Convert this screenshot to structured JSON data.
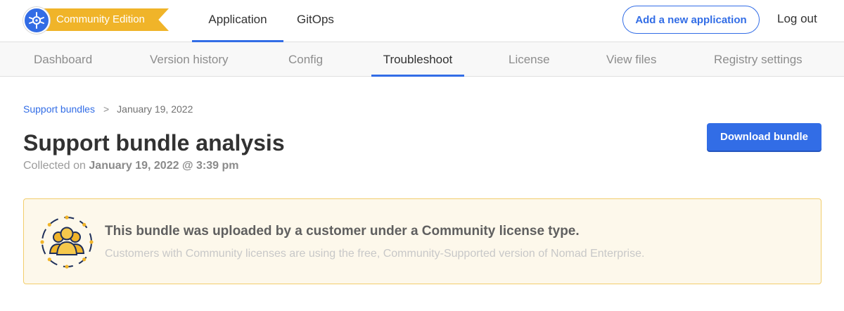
{
  "header": {
    "edition_badge": "Community Edition",
    "tabs": [
      {
        "label": "Application",
        "active": true
      },
      {
        "label": "GitOps",
        "active": false
      }
    ],
    "add_app_label": "Add a new application",
    "logout_label": "Log out"
  },
  "subnav": {
    "tabs": [
      {
        "label": "Dashboard",
        "active": false
      },
      {
        "label": "Version history",
        "active": false
      },
      {
        "label": "Config",
        "active": false
      },
      {
        "label": "Troubleshoot",
        "active": true
      },
      {
        "label": "License",
        "active": false
      },
      {
        "label": "View files",
        "active": false
      },
      {
        "label": "Registry settings",
        "active": false
      }
    ]
  },
  "breadcrumb": {
    "parent": "Support bundles",
    "separator": ">",
    "current": "January 19, 2022"
  },
  "main": {
    "title": "Support bundle analysis",
    "collected_prefix": "Collected on",
    "collected_date": "January 19, 2022 @ 3:39 pm",
    "download_label": "Download bundle"
  },
  "notice": {
    "icon": "community-users-icon",
    "title": "This bundle was uploaded by a customer under a Community license type.",
    "subtitle": "Customers with Community licenses are using the free, Community-Supported version of Nomad Enterprise."
  },
  "colors": {
    "accent": "#326de6",
    "badge": "#f0b429",
    "notice_bg": "#fdf8eb",
    "notice_border": "#f2cd6c"
  }
}
